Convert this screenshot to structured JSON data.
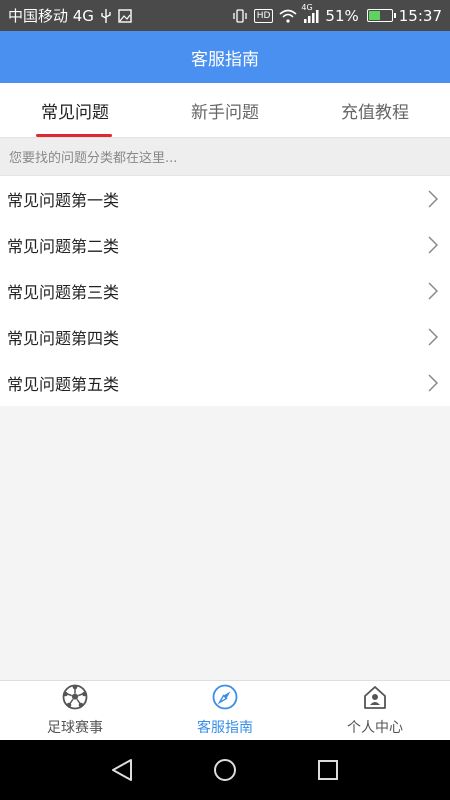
{
  "status_bar": {
    "carrier": "中国移动 4G",
    "signal_label": "4G",
    "battery_percent": "51%",
    "battery_level": 0.51,
    "time": "15:37"
  },
  "header": {
    "title": "客服指南"
  },
  "tabs": [
    {
      "label": "常见问题",
      "active": true
    },
    {
      "label": "新手问题",
      "active": false
    },
    {
      "label": "充值教程",
      "active": false
    }
  ],
  "hint": "您要找的问题分类都在这里...",
  "list": [
    {
      "label": "常见问题第一类"
    },
    {
      "label": "常见问题第二类"
    },
    {
      "label": "常见问题第三类"
    },
    {
      "label": "常见问题第四类"
    },
    {
      "label": "常见问题第五类"
    }
  ],
  "bottom_nav": [
    {
      "label": "足球赛事",
      "icon": "soccer-ball-icon",
      "active": false
    },
    {
      "label": "客服指南",
      "icon": "compass-icon",
      "active": true
    },
    {
      "label": "个人中心",
      "icon": "house-user-icon",
      "active": false
    }
  ],
  "colors": {
    "accent": "#4a90f0",
    "tab_indicator": "#e0292e",
    "nav_active": "#3a8ee6"
  }
}
